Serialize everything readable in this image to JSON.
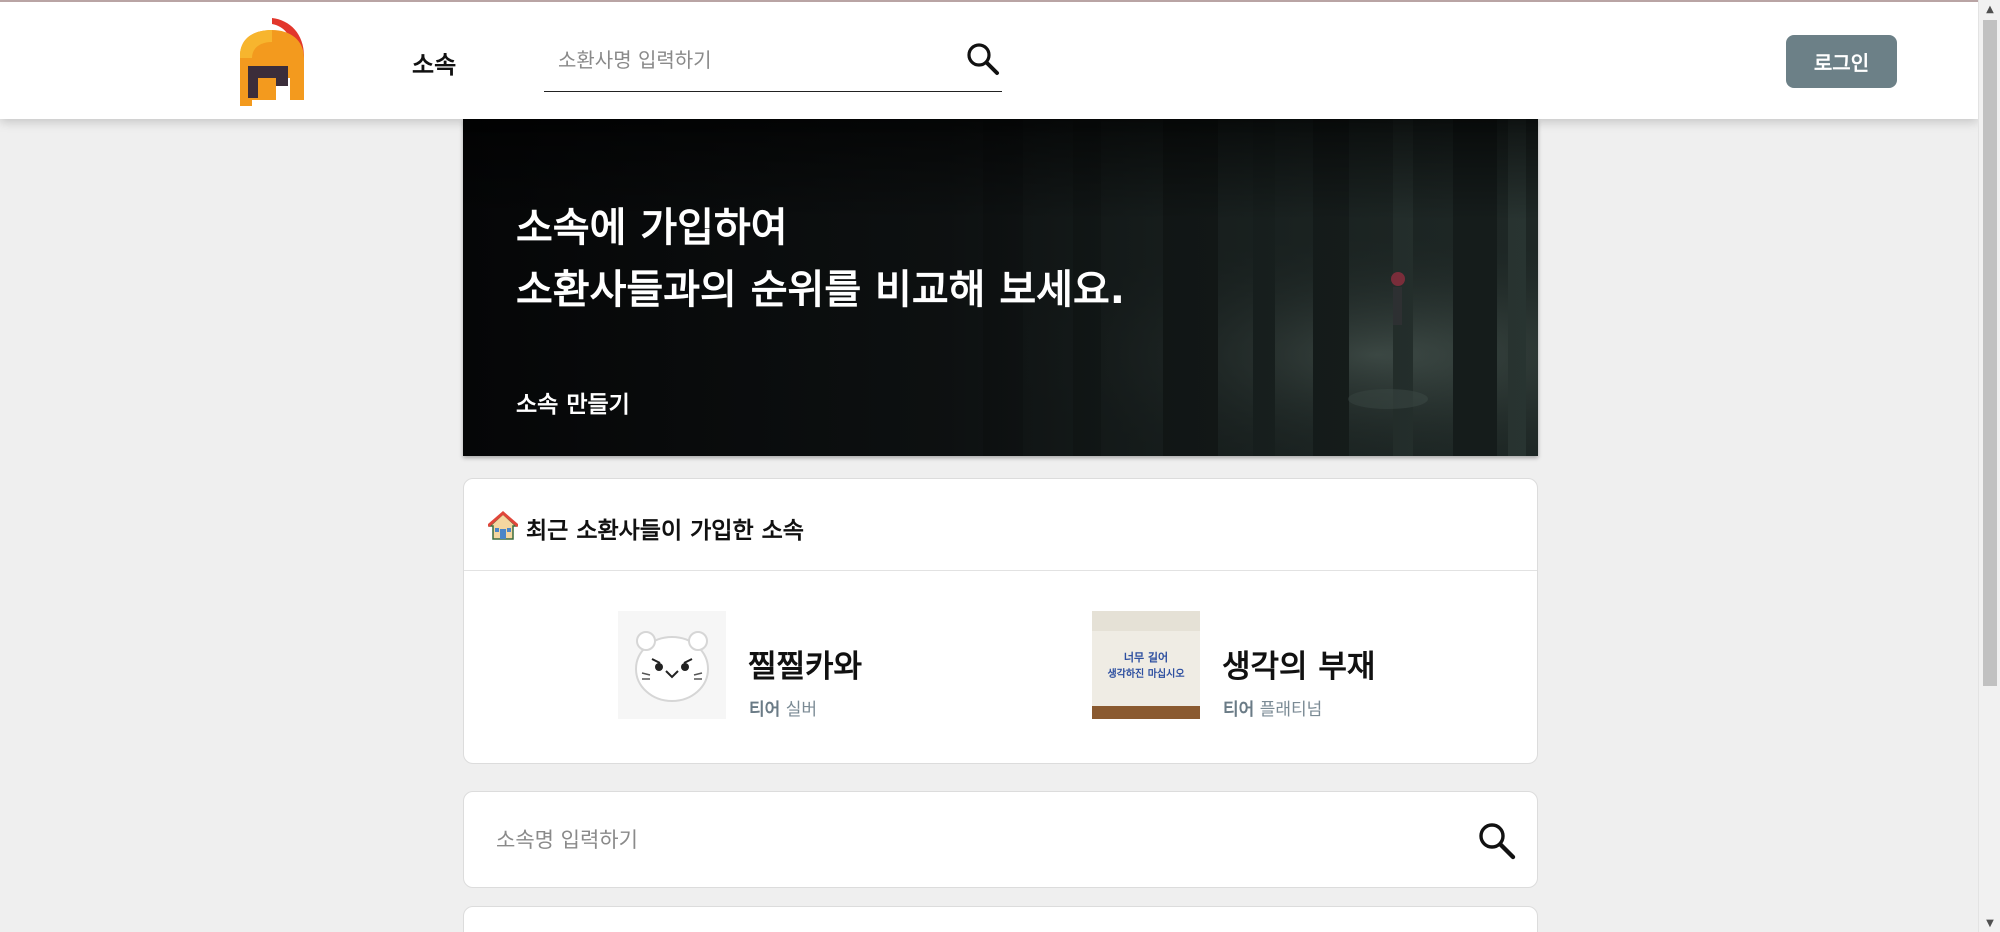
{
  "header": {
    "nav_label": "소속",
    "search_placeholder": "소환사명 입력하기",
    "login_label": "로그인"
  },
  "hero": {
    "title_line1": "소속에 가입하여",
    "title_line2": "소환사들과의 순위를 비교해 보세요.",
    "create_label": "소속 만들기"
  },
  "recent": {
    "title": "최근 소환사들이 가입한 소속",
    "clans": [
      {
        "name": "찔찔카와",
        "tier_label": "티어",
        "tier": "실버",
        "thumb_icon": "white-bear-face"
      },
      {
        "name": "생각의 부재",
        "tier_label": "티어",
        "tier": "플래티넘",
        "thumb_icon": "towel-photo",
        "thumb_text_line1": "너무 길어",
        "thumb_text_line2": "생각하진 마십시오"
      }
    ]
  },
  "clan_search": {
    "placeholder": "소속명 입력하기"
  },
  "colors": {
    "login_button": "#6c8087",
    "page_background": "#efefef",
    "tier_text": "#7a8a94"
  }
}
